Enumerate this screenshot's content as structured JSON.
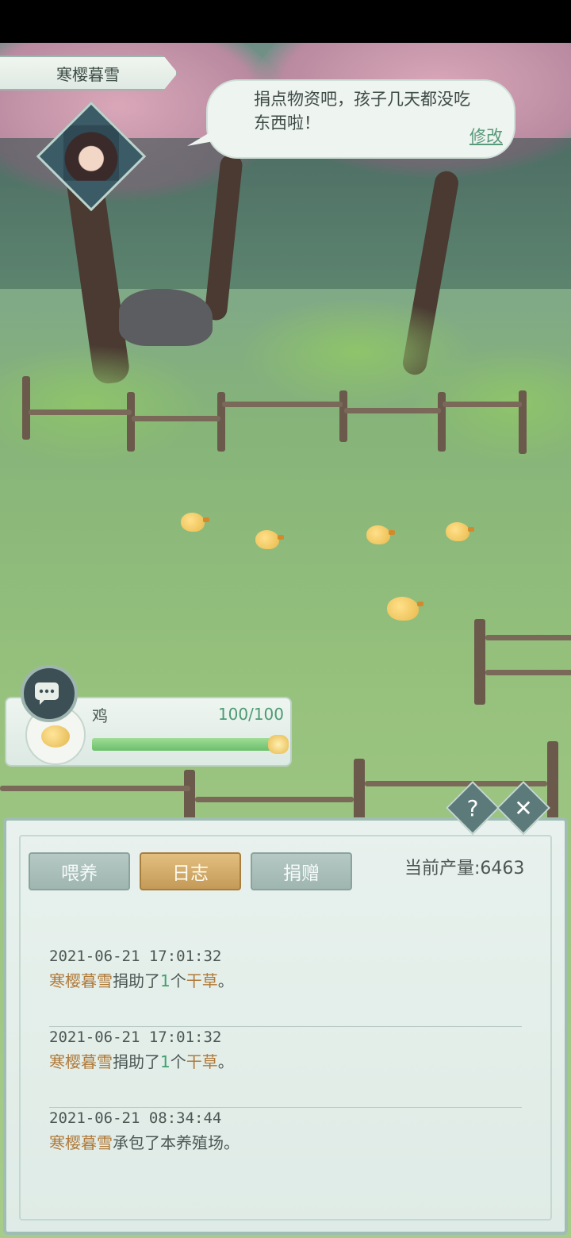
{
  "npc": {
    "name": "寒樱暮雪",
    "speech": "捐点物资吧，孩子几天都没吃东西啦！",
    "edit_label": "修改"
  },
  "animal": {
    "name": "鸡",
    "hp_text": "100/100",
    "hp_fraction": 1.0
  },
  "panel": {
    "tabs": [
      {
        "label": "喂养",
        "active": false
      },
      {
        "label": "日志",
        "active": true
      },
      {
        "label": "捐赠",
        "active": false
      }
    ],
    "production_label": "当前产量:6463",
    "help_symbol": "?",
    "close_symbol": "✕"
  },
  "log": [
    {
      "time": "2021-06-21  17:01:32",
      "name": "寒樱暮雪",
      "action": "捐助了",
      "count": "1",
      "unit": "个",
      "item": "干草",
      "end": "。"
    },
    {
      "time": "2021-06-21  17:01:32",
      "name": "寒樱暮雪",
      "action": "捐助了",
      "count": "1",
      "unit": "个",
      "item": "干草",
      "end": "。"
    },
    {
      "time": "2021-06-21  08:34:44",
      "name": "寒樱暮雪",
      "action": "承包了本养殖场。",
      "count": "",
      "unit": "",
      "item": "",
      "end": ""
    }
  ],
  "colors": {
    "accent_green": "#4c9a73",
    "accent_gold": "#b07a3a",
    "panel_bg": "#e8f1ed"
  }
}
